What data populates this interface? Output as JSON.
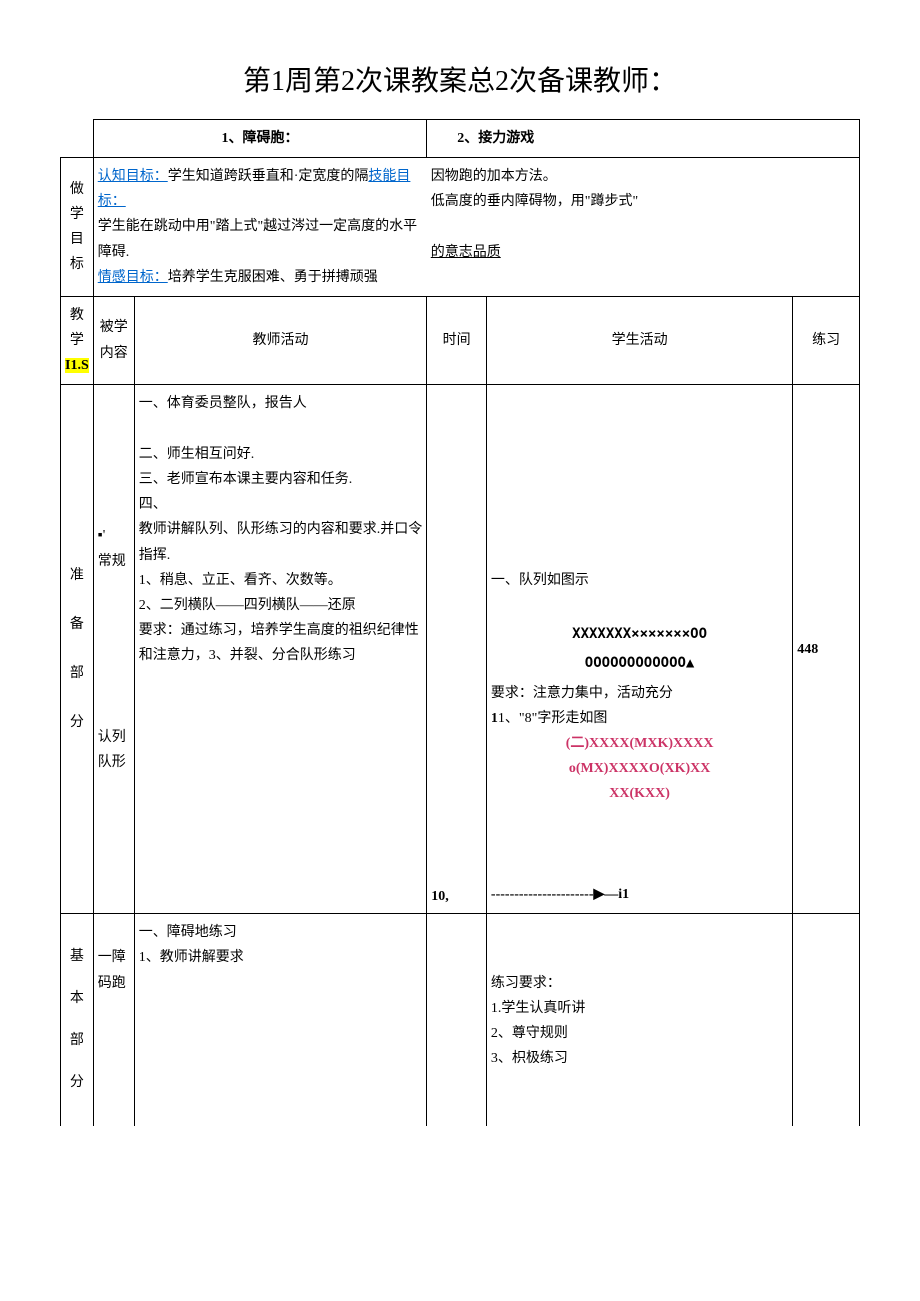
{
  "title": "第1周第2次课教案总2次备课教师：",
  "row1": {
    "left": "1、障碍胞：",
    "right": "2、接力游戏"
  },
  "goals_label": "做学目标",
  "goals": {
    "cognitive_label": "认知目标：",
    "cognitive_text": "学生知道跨跃垂直和·定宽度的隔",
    "skill_label": "技能目标：",
    "skill_text": "因物跑的加本方法。",
    "line2_left": "学生能在跳动中用\"踏上式\"越过涔过一定高度的水平障碍.",
    "line2_right": "低高度的垂内障碍物，用\"蹲步式\"",
    "emotion_label": "情感目标：",
    "emotion_text": "培养学生克服困难、勇于拼搏顽强",
    "emotion_suffix": "的意志品质"
  },
  "headers": {
    "stage1": "教学",
    "stage2": "I1.S",
    "content": "被学内容",
    "teacher": "教师活动",
    "time": "时间",
    "student": "学生活动",
    "practice": "练习"
  },
  "prep": {
    "stage_lines": [
      "准",
      "备",
      "部",
      "分"
    ],
    "content_dot": "▪'",
    "content1": "常规",
    "content2": "认列队形",
    "teacher": "一、体育委员整队，报告人\n\n二、师生相互问好.\n三、老师宣布本课主要内容和任务.\n四、\n教师讲解队列、队形练习的内容和要求.并口令指挥.\n1、稍息、立正、看齐、次数等。\n2、二列横队——四列横队——还原\n要求：通过练习，培养学生高度的祖织纪律性和注意力，3、并裂、分合队形练习",
    "time": "10,",
    "student": {
      "line1": "一、队列如图示",
      "diagram1a": "XXXXXXX×××××××OO",
      "diagram1b": "OOOOOOOOOOOO▲",
      "line2": "要求：注意力集中，活动充分",
      "line3": "1、\"8\"字形走如图",
      "diagram2a": "(二)XXXX(MXK)XXXX",
      "diagram2b": "o(MX)XXXXO(XK)XX",
      "diagram2c": "XX(KXX)",
      "arrow": "----------------------▶—i1"
    },
    "practice": "448"
  },
  "basic": {
    "stage_lines": [
      "基",
      "本",
      "部",
      "分"
    ],
    "content": "一障码跑",
    "teacher": "一、障碍地练习\n1、教师讲解要求",
    "student": "练习要求：\n1.学生认真听讲\n2、尊守规则\n3、枳极练习"
  }
}
